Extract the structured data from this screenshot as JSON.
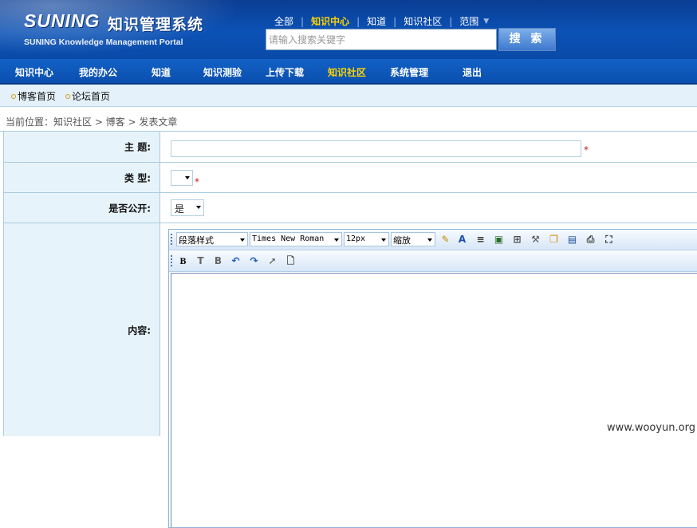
{
  "header": {
    "logo_main": "SUNING",
    "logo_cn": "知识管理系统",
    "logo_sub": "SUNING Knowledge Management Portal",
    "scopes": [
      "全部",
      "知识中心",
      "知道",
      "知识社区",
      "范围"
    ],
    "active_scope": "知识中心",
    "search_placeholder": "请输入搜索关键字",
    "search_button": "搜 索"
  },
  "nav": {
    "items": [
      "知识中心",
      "我的办公",
      "知道",
      "知识测验",
      "上传下载",
      "知识社区",
      "系统管理",
      "退出"
    ],
    "active": "知识社区"
  },
  "subnav": {
    "items": [
      "博客首页",
      "论坛首页"
    ]
  },
  "breadcrumb": "当前位置：知识社区 > 博客 > 发表文章",
  "form": {
    "subject_label": "主  题:",
    "type_label": "类  型:",
    "public_label": "是否公开:",
    "public_value": "是",
    "content_label": "内容:",
    "required_mark": "*"
  },
  "editor": {
    "paragraph_style": "段落样式",
    "font_family": "Times New Roman",
    "font_size": "12px",
    "zoom": "缩放",
    "toolbar_icons_row1": [
      "highlight-icon",
      "font-color-icon",
      "align-icon",
      "insert-image-icon",
      "table-icon",
      "tools-icon",
      "copy-icon",
      "form-icon",
      "print-icon",
      "fullscreen-icon"
    ],
    "toolbar_icons_row2": [
      "bold-icon",
      "text-background-icon",
      "background-icon",
      "undo-icon",
      "redo-icon",
      "select-icon",
      "new-document-icon"
    ]
  },
  "watermark": "www.wooyun.org"
}
